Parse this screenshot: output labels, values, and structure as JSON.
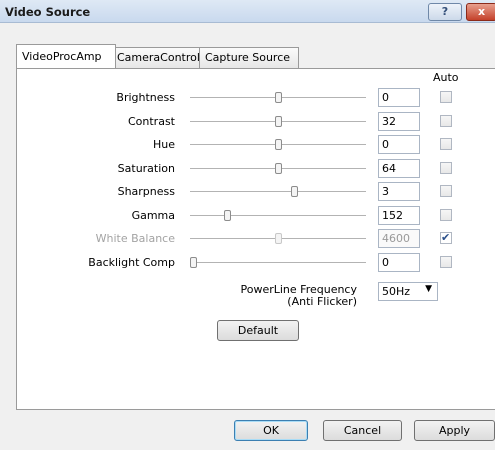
{
  "window": {
    "title": "Video Source",
    "help_label": "?",
    "close_label": "x"
  },
  "tabs": [
    "VideoProcAmp",
    "CameraControl",
    "Capture Source"
  ],
  "auto_header": "Auto",
  "properties": [
    {
      "label": "Brightness",
      "value": "0",
      "level": 0.5,
      "auto": false,
      "enabled": true
    },
    {
      "label": "Contrast",
      "value": "32",
      "level": 0.5,
      "auto": false,
      "enabled": true
    },
    {
      "label": "Hue",
      "value": "0",
      "level": 0.5,
      "auto": false,
      "enabled": true
    },
    {
      "label": "Saturation",
      "value": "64",
      "level": 0.5,
      "auto": false,
      "enabled": true
    },
    {
      "label": "Sharpness",
      "value": "3",
      "level": 0.6,
      "auto": false,
      "enabled": true
    },
    {
      "label": "Gamma",
      "value": "152",
      "level": 0.2,
      "auto": false,
      "enabled": true
    },
    {
      "label": "White Balance",
      "value": "4600",
      "level": 0.5,
      "auto": true,
      "enabled": false
    },
    {
      "label": "Backlight Comp",
      "value": "0",
      "level": 0.0,
      "auto": false,
      "enabled": true
    }
  ],
  "powerline": {
    "label_line1": "PowerLine Frequency",
    "label_line2": "(Anti Flicker)",
    "value": "50Hz"
  },
  "buttons": {
    "default": "Default",
    "ok": "OK",
    "cancel": "Cancel",
    "apply": "Apply"
  },
  "colors": {
    "titlebar": "#c9d9ee",
    "close": "#c4412b",
    "check": "#2a4f8a"
  }
}
